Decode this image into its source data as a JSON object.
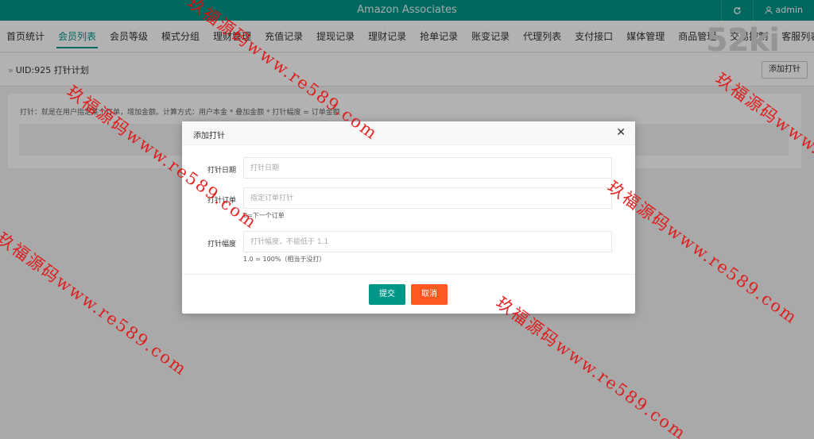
{
  "header": {
    "title": "Amazon Associates",
    "refresh_icon": "refresh-icon",
    "user_icon": "user-icon",
    "user": "admin"
  },
  "nav": {
    "items": [
      "首页统计",
      "会员列表",
      "会员等级",
      "模式分组",
      "理财管理",
      "充值记录",
      "提现记录",
      "理财记录",
      "抢单记录",
      "账变记录",
      "代理列表",
      "支付接口",
      "媒体管理",
      "商品管理",
      "交易控制",
      "客服列表"
    ],
    "active_index": 1
  },
  "logo_text": "52ki",
  "breadcrumb": {
    "text": "UID:925 打针计划",
    "add_button": "添加打针"
  },
  "card": {
    "note": "打针：就是在用户指定某个订单，增加金额。计算方式：用户本金 * 叠加金额 * 打针幅度 = 订单金额"
  },
  "modal": {
    "title": "添加打针",
    "close_icon": "close-icon",
    "fields": [
      {
        "label": "打针日期",
        "placeholder": "打针日期",
        "hint": ""
      },
      {
        "label": "打针订单",
        "placeholder": "指定订单打针",
        "hint": "0=下一个订单"
      },
      {
        "label": "打针幅度",
        "placeholder": "打针幅度，不能低于 1.1",
        "hint": "1.0 = 100%（相当于没打）"
      }
    ],
    "submit": "提交",
    "cancel": "取消"
  },
  "watermarks": [
    "玖福源码www.re589.com",
    "玖福源码www.re589.com",
    "玖福源码www.re589.com",
    "玖福源码www.re589.com",
    "玖福源码www.re589.com",
    "玖福源码www.re589.com"
  ]
}
